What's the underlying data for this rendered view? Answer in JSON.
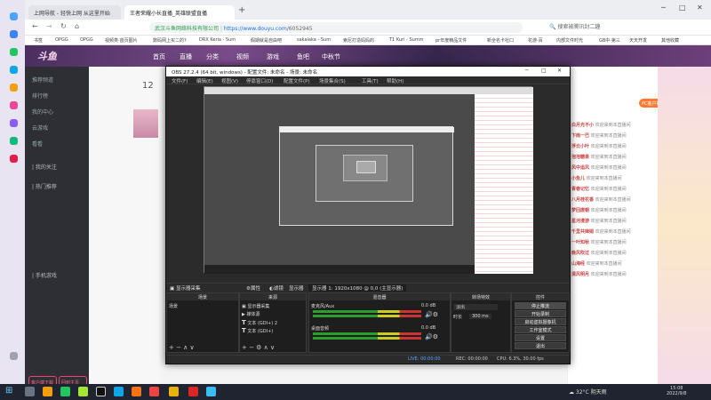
{
  "browser": {
    "tabs": [
      {
        "label": "上网导航 - 轻快上网 从这里开始"
      },
      {
        "label": "王者荣耀小长直播_英雄联盟直播"
      }
    ],
    "tab_add": "+",
    "url_host": "https://www.douyu.com",
    "url_path": "/6052945",
    "url_prefix": "武汉斗鱼网络科技有限公司",
    "search_hint": "搜索被腾讯封二趣",
    "bookmarks": [
      "书签",
      "OPGG",
      "OPGG",
      "视频类·首页图片",
      "数码网上买二的?",
      "DRX Keria - Sum",
      "假期就是自由吧",
      "sakalaka - Sum",
      "索尼打造妈妈的",
      "T1 Kuri - Summ",
      "pr年度精品文件",
      "新全名卡社口",
      "花游·百",
      "内部文件时光",
      "GB中·第三",
      "天天开发",
      "其他收藏"
    ]
  },
  "site": {
    "brand": "斗鱼",
    "nav": [
      "首页",
      "直播",
      "分类",
      "视频",
      "游戏",
      "鱼吧",
      "中秋节"
    ],
    "sidebar": [
      "推荐频道",
      "排行榜",
      "我的中心",
      "云游戏",
      "看看"
    ],
    "sidebar_section": "| 我的关注",
    "sidebar_section2": "| 热门推荐",
    "sidebar_section3": "| 手机游戏",
    "sidebar_buttons": [
      "客户端下载",
      "回到主页"
    ],
    "count": "12",
    "pc_button": "PC客户端",
    "chat_rows": [
      {
        "name": "白月光不小",
        "text": "欢迎来到本直播间"
      },
      {
        "name": "下雨一巴",
        "text": "欢迎来到本直播间"
      },
      {
        "name": "浮云小叶",
        "text": "欢迎来到本直播间"
      },
      {
        "name": "泡泡糖果",
        "text": "欢迎来到本直播间"
      },
      {
        "name": "风中追风",
        "text": "欢迎来到本直播间"
      },
      {
        "name": "小鱼儿",
        "text": "欢迎来到本直播间"
      },
      {
        "name": "青春记忆",
        "text": "欢迎来到本直播间"
      },
      {
        "name": "八月桂花香",
        "text": "欢迎来到本直播间"
      },
      {
        "name": "梦回唐朝",
        "text": "欢迎来到本直播间"
      },
      {
        "name": "星河漫游",
        "text": "欢迎来到本直播间"
      },
      {
        "name": "千里共婵娟",
        "text": "欢迎来到本直播间"
      },
      {
        "name": "一叶知秋",
        "text": "欢迎来到本直播间"
      },
      {
        "name": "晚风吹过",
        "text": "欢迎来到本直播间"
      },
      {
        "name": "山海经",
        "text": "欢迎来到本直播间"
      },
      {
        "name": "清风明月",
        "text": "欢迎来到本直播间"
      }
    ]
  },
  "obs": {
    "title": "OBS 27.2.4 (64 bit, windows) - 配置文件: 未命名 - 场景: 未命名",
    "menu": [
      "文件(F)",
      "编辑(E)",
      "视图(V)",
      "停靠窗口(D)",
      "配置文件(P)",
      "场景集合(S)",
      "工具(T)",
      "帮助(H)"
    ],
    "ctx_bar": {
      "source": "显示器采集",
      "props": "属性",
      "filter": "滤镜",
      "display": "显示器",
      "resolution": "显示器 1: 1920x1080 @ 0,0 (主显示器)"
    },
    "panels": {
      "scenes": "场景",
      "sources": "来源",
      "mixer": "混音器",
      "transitions": "转场特效",
      "controls": "控件"
    },
    "scene_items": [
      "场景"
    ],
    "source_items": [
      "显示器采集",
      "媒体源",
      "文本 (GDI+) 2",
      "文本 (GDI+)"
    ],
    "mixer_tracks": [
      {
        "name": "麦克风/Aux",
        "db": "0.0 dB"
      },
      {
        "name": "桌面音频",
        "db": "0.0 dB"
      }
    ],
    "transition": {
      "type": "淡出",
      "duration_label": "时长",
      "duration": "300 ms"
    },
    "controls": [
      "停止推流",
      "开始录制",
      "启动虚拟摄像机",
      "工作室模式",
      "设置",
      "退出"
    ],
    "status": {
      "live": "LIVE: 00:00:00",
      "rec": "REC: 00:00:00",
      "cpu": "CPU: 6.3%, 30.00 fps"
    }
  },
  "taskbar": {
    "weather": "32°C 阴天雨",
    "time": "15:08",
    "date": "2022/9/8"
  }
}
